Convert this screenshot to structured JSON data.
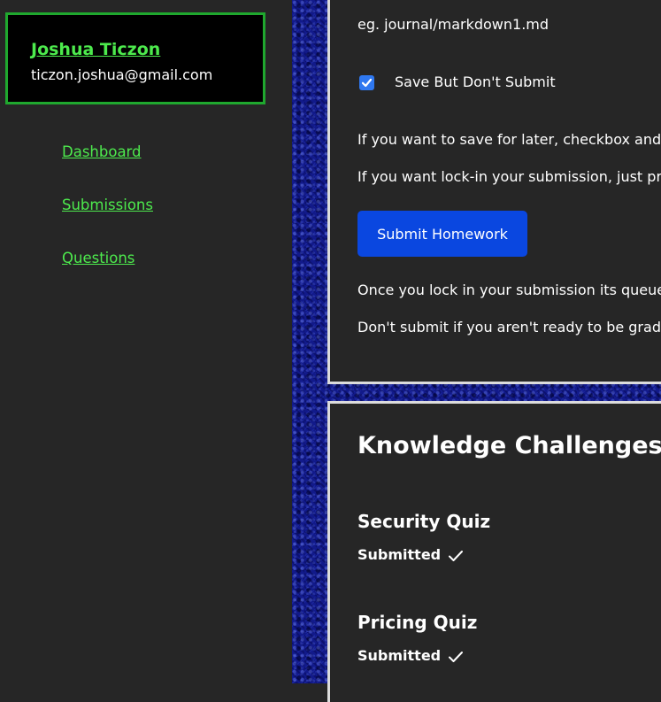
{
  "user": {
    "name": "Joshua Ticzon",
    "email": "ticzon.joshua@gmail.com"
  },
  "nav": {
    "items": [
      {
        "label": "Dashboard"
      },
      {
        "label": "Submissions"
      },
      {
        "label": "Questions"
      }
    ]
  },
  "submission": {
    "path_example": "eg. journal/markdown1.md",
    "save_checkbox_label": "Save But Don't Submit",
    "save_checked": true,
    "info_save": "If you want to save for later, checkbox and",
    "info_lock": "If you want lock-in your submission, just pr",
    "submit_button": "Submit Homework",
    "info_queue": "Once you lock in your submission its queue",
    "info_ready": "Don't submit if you aren't ready to be grade"
  },
  "knowledge": {
    "heading": "Knowledge Challenges",
    "quizzes": [
      {
        "title": "Security Quiz",
        "status": "Submitted",
        "icon": "check-icon"
      },
      {
        "title": "Pricing Quiz",
        "status": "Submitted",
        "icon": "check-icon"
      }
    ]
  },
  "colors": {
    "accent_green": "#4dea4d",
    "card_border": "#1fa82e",
    "button_blue": "#0a47e0",
    "checkbox_blue": "#2f78f0",
    "texture_blue": "#121a8a"
  }
}
